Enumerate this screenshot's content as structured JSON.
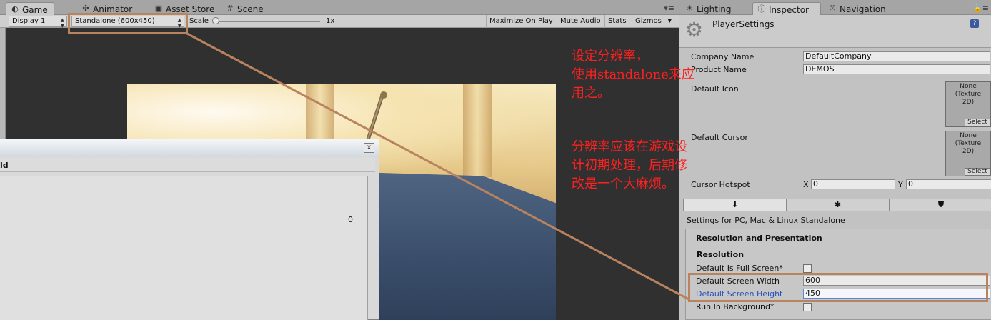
{
  "game": {
    "tabs": [
      {
        "label": "Game",
        "icon": "game-icon"
      },
      {
        "label": "Animator",
        "icon": "animator-icon"
      },
      {
        "label": "Asset Store",
        "icon": "asset-store-icon"
      },
      {
        "label": "Scene",
        "icon": "scene-icon"
      }
    ],
    "menu": "▾≡",
    "toolbar": {
      "display": "Display 1",
      "resolution": "Standalone (600x450)",
      "scale_label": "Scale",
      "scale_value": "1x",
      "maximize_on_play": "Maximize On Play",
      "mute_audio": "Mute Audio",
      "stats": "Stats",
      "gizmos": "Gizmos"
    },
    "dialog": {
      "heading": "ld",
      "value": "0",
      "close": "x"
    }
  },
  "inspector": {
    "tabs": [
      {
        "label": "Lighting",
        "icon": "lighting-icon"
      },
      {
        "label": "Inspector",
        "icon": "inspector-icon"
      },
      {
        "label": "Navigation",
        "icon": "navigation-icon"
      }
    ],
    "title": "PlayerSettings",
    "help": "?",
    "company_name_label": "Company Name",
    "company_name": "DefaultCompany",
    "product_name_label": "Product Name",
    "product_name": "DEMOS",
    "default_icon_label": "Default Icon",
    "default_cursor_label": "Default Cursor",
    "texture_none": "None\n(Texture\n2D)",
    "select_label": "Select",
    "cursor_hotspot_label": "Cursor Hotspot",
    "hotspot_x_label": "X",
    "hotspot_x": "0",
    "hotspot_y_label": "Y",
    "hotspot_y": "0",
    "platform_tabs": [
      "PC, Mac & Linux",
      "Android",
      "WebGL"
    ],
    "settings_for": "Settings for PC, Mac & Linux Standalone",
    "section_title": "Resolution and Presentation",
    "subsection_title": "Resolution",
    "full_screen_label": "Default Is Full Screen*",
    "full_screen_checked": false,
    "width_label": "Default Screen Width",
    "width_value": "600",
    "height_label": "Default Screen Height",
    "height_value": "450",
    "run_in_bg_label": "Run In Background*",
    "run_in_bg_checked": false
  },
  "annotations": {
    "note1": "设定分辨率，\n使用standalone来应\n用之。",
    "note2": "分辨率应该在游戏设\n计初期处理，后期修\n改是一个大麻烦。",
    "color": "#ff2020",
    "highlight_color": "#b8835e"
  }
}
